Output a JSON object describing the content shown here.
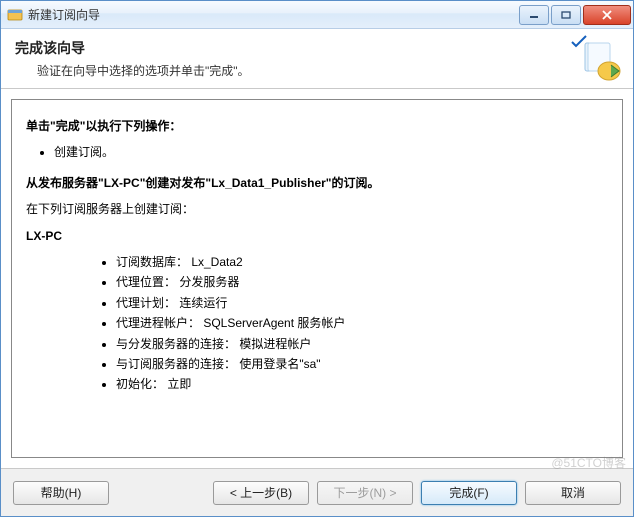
{
  "window": {
    "title": "新建订阅向导"
  },
  "header": {
    "title": "完成该向导",
    "subtitle": "验证在向导中选择的选项并单击\"完成\"。"
  },
  "content": {
    "heading": "单击\"完成\"以执行下列操作：",
    "action_item": "创建订阅。",
    "create_from": "从发布服务器\"LX-PC\"创建对发布\"Lx_Data1_Publisher\"的订阅。",
    "subscribe_on": "在下列订阅服务器上创建订阅：",
    "server_name": "LX-PC",
    "details": [
      "订阅数据库： Lx_Data2",
      "代理位置： 分发服务器",
      "代理计划： 连续运行",
      "代理进程帐户： SQLServerAgent 服务帐户",
      "与分发服务器的连接： 模拟进程帐户",
      "与订阅服务器的连接： 使用登录名\"sa\"",
      "初始化： 立即"
    ]
  },
  "footer": {
    "help": "帮助(H)",
    "back": "< 上一步(B)",
    "next": "下一步(N) >",
    "finish": "完成(F)",
    "cancel": "取消"
  },
  "watermark": "@51CTO博客"
}
